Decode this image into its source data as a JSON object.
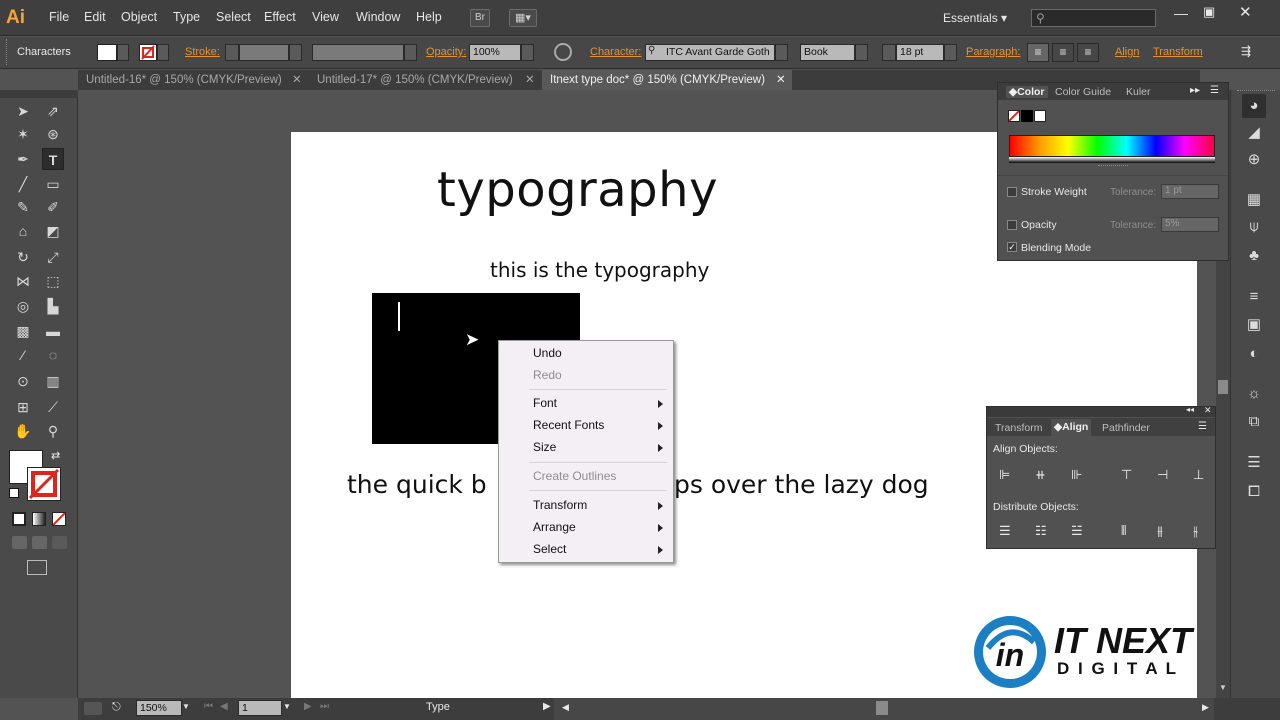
{
  "app": {
    "logo": "Ai"
  },
  "menu": [
    "File",
    "Edit",
    "Object",
    "Type",
    "Select",
    "Effect",
    "View",
    "Window",
    "Help"
  ],
  "bridge_label": "Br",
  "workspace": {
    "label": "Essentials",
    "search_placeholder": ""
  },
  "control": {
    "context_label": "Characters",
    "stroke_label": "Stroke:",
    "opacity_label": "Opacity:",
    "opacity_value": "100%",
    "character_label": "Character:",
    "font_value": "ITC Avant Garde Goth",
    "style_value": "Book",
    "size_value": "18 pt",
    "paragraph_label": "Paragraph:",
    "align_label": "Align",
    "transform_label": "Transform"
  },
  "tabs": [
    {
      "label": "Untitled-16* @ 150% (CMYK/Preview)"
    },
    {
      "label": "Untitled-17* @ 150% (CMYK/Preview)"
    },
    {
      "label": "Itnext type doc* @ 150% (CMYK/Preview)"
    }
  ],
  "artboard": {
    "heading": "typography",
    "subheading": "this is the typography",
    "line_left": "the quick b",
    "line_right": "ps over the lazy dog"
  },
  "context_menu": {
    "undo": "Undo",
    "redo": "Redo",
    "font": "Font",
    "recent_fonts": "Recent Fonts",
    "size": "Size",
    "create_outlines": "Create Outlines",
    "transform": "Transform",
    "arrange": "Arrange",
    "select": "Select"
  },
  "color_panel": {
    "tab_color": "Color",
    "tab_guide": "Color Guide",
    "tab_kuler": "Kuler",
    "stroke_weight": "Stroke Weight",
    "tolerance_label": "Tolerance:",
    "stroke_tol": "1 pt",
    "opacity": "Opacity",
    "opacity_tol": "5%",
    "blending": "Blending Mode"
  },
  "align_panel": {
    "tab_transform": "Transform",
    "tab_align": "Align",
    "tab_pathfinder": "Pathfinder",
    "align_objects": "Align Objects:",
    "distribute_objects": "Distribute Objects:"
  },
  "status": {
    "zoom": "150%",
    "page": "1",
    "tool": "Type"
  },
  "watermark": {
    "line1": "IT NEXT",
    "line2": "D I G I T A L"
  },
  "colors": {
    "accent": "#e3922f",
    "artboard": "#ffffff",
    "menu_bg": "#f4eef5"
  }
}
